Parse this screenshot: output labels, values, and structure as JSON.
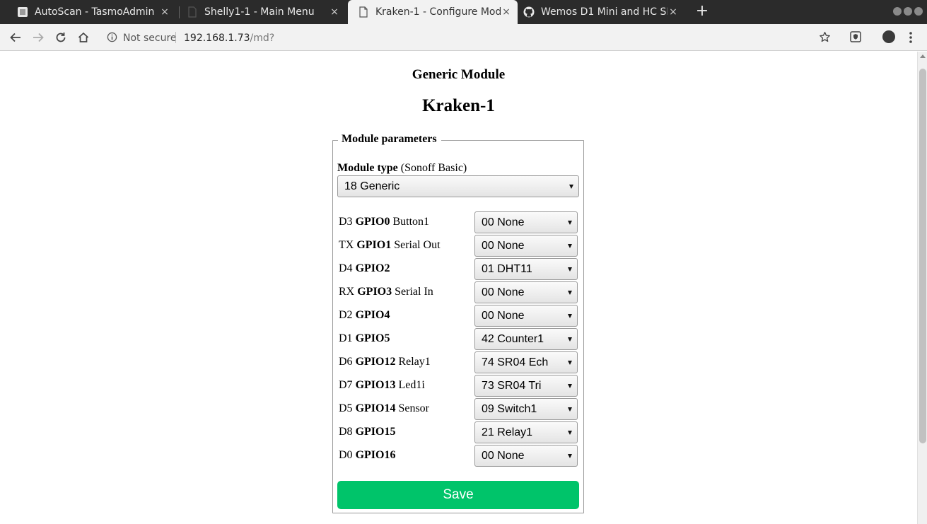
{
  "browser": {
    "tabs": [
      {
        "title": "AutoScan - TasmoAdmin",
        "icon": "tasmoadmin-favicon",
        "active": false
      },
      {
        "title": "Shelly1-1 - Main Menu",
        "icon": "page-icon",
        "active": false
      },
      {
        "title": "Kraken-1 - Configure Module",
        "icon": "page-icon",
        "active": true
      },
      {
        "title": "Wemos D1 Mini and HC SR04",
        "icon": "github-icon",
        "active": false
      }
    ],
    "new_tab": "+",
    "close_glyph": "×",
    "url": {
      "security": "Not secure",
      "host": "192.168.1.73",
      "path": "/md?"
    }
  },
  "page": {
    "module_heading": "Generic Module",
    "device_name": "Kraken-1",
    "fieldset_legend": "Module parameters",
    "module_type": {
      "label": "Module type",
      "note": "(Sonoff Basic)",
      "selected": "18 Generic"
    },
    "gpio_rows": [
      {
        "pin": "D3",
        "gpio": "GPIO0",
        "func": "Button1",
        "selected": "00 None"
      },
      {
        "pin": "TX",
        "gpio": "GPIO1",
        "func": "Serial Out",
        "selected": "00 None"
      },
      {
        "pin": "D4",
        "gpio": "GPIO2",
        "func": "",
        "selected": "01 DHT11"
      },
      {
        "pin": "RX",
        "gpio": "GPIO3",
        "func": "Serial In",
        "selected": "00 None"
      },
      {
        "pin": "D2",
        "gpio": "GPIO4",
        "func": "",
        "selected": "00 None"
      },
      {
        "pin": "D1",
        "gpio": "GPIO5",
        "func": "",
        "selected": "42 Counter1"
      },
      {
        "pin": "D6",
        "gpio": "GPIO12",
        "func": "Relay1",
        "selected": "74 SR04 Ech"
      },
      {
        "pin": "D7",
        "gpio": "GPIO13",
        "func": "Led1i",
        "selected": "73 SR04 Tri"
      },
      {
        "pin": "D5",
        "gpio": "GPIO14",
        "func": "Sensor",
        "selected": "09 Switch1"
      },
      {
        "pin": "D8",
        "gpio": "GPIO15",
        "func": "",
        "selected": "21 Relay1"
      },
      {
        "pin": "D0",
        "gpio": "GPIO16",
        "func": "",
        "selected": "00 None"
      }
    ],
    "save_label": "Save"
  },
  "colors": {
    "save_button": "#00c46a",
    "tabbar": "#2b2b2b",
    "toolbar": "#f2f2f2"
  }
}
